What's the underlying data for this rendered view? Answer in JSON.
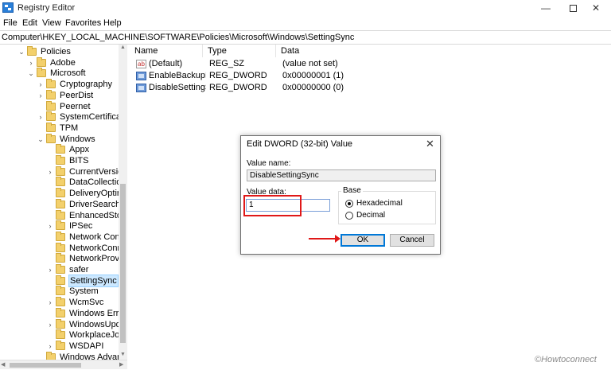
{
  "window": {
    "title": "Registry Editor",
    "min_glyph": "—",
    "close_glyph": "✕"
  },
  "menu": [
    "File",
    "Edit",
    "View",
    "Favorites",
    "Help"
  ],
  "address": "Computer\\HKEY_LOCAL_MACHINE\\SOFTWARE\\Policies\\Microsoft\\Windows\\SettingSync",
  "tree": [
    {
      "label": "Policies",
      "chev": "⌄",
      "level": 0
    },
    {
      "label": "Adobe",
      "chev": "›",
      "level": 1
    },
    {
      "label": "Microsoft",
      "chev": "⌄",
      "level": 1
    },
    {
      "label": "Cryptography",
      "chev": "›",
      "level": 2
    },
    {
      "label": "PeerDist",
      "chev": "›",
      "level": 2
    },
    {
      "label": "Peernet",
      "chev": "",
      "level": 2
    },
    {
      "label": "SystemCertificates",
      "chev": "›",
      "level": 2
    },
    {
      "label": "TPM",
      "chev": "",
      "level": 2
    },
    {
      "label": "Windows",
      "chev": "⌄",
      "level": 2
    },
    {
      "label": "Appx",
      "chev": "",
      "level": 3
    },
    {
      "label": "BITS",
      "chev": "",
      "level": 3
    },
    {
      "label": "CurrentVersion",
      "chev": "›",
      "level": 3
    },
    {
      "label": "DataCollection",
      "chev": "",
      "level": 3
    },
    {
      "label": "DeliveryOptimiz",
      "chev": "",
      "level": 3
    },
    {
      "label": "DriverSearching",
      "chev": "",
      "level": 3
    },
    {
      "label": "EnhancedStorag",
      "chev": "",
      "level": 3
    },
    {
      "label": "IPSec",
      "chev": "›",
      "level": 3
    },
    {
      "label": "Network Conne",
      "chev": "",
      "level": 3
    },
    {
      "label": "NetworkConnec",
      "chev": "",
      "level": 3
    },
    {
      "label": "NetworkProvide",
      "chev": "",
      "level": 3
    },
    {
      "label": "safer",
      "chev": "›",
      "level": 3
    },
    {
      "label": "SettingSync",
      "chev": "",
      "level": 3,
      "selected": true
    },
    {
      "label": "System",
      "chev": "",
      "level": 3
    },
    {
      "label": "WcmSvc",
      "chev": "›",
      "level": 3
    },
    {
      "label": "Windows Error I",
      "chev": "",
      "level": 3
    },
    {
      "label": "WindowsUpdat",
      "chev": "›",
      "level": 3
    },
    {
      "label": "WorkplaceJoin",
      "chev": "",
      "level": 3
    },
    {
      "label": "WSDAPI",
      "chev": "›",
      "level": 3
    },
    {
      "label": "Windows Advance",
      "chev": "",
      "level": 2
    }
  ],
  "list": {
    "headers": {
      "name": "Name",
      "type": "Type",
      "data": "Data"
    },
    "rows": [
      {
        "icon": "string-value-icon",
        "name": "(Default)",
        "type": "REG_SZ",
        "data": "(value not set)"
      },
      {
        "icon": "dword-value-icon",
        "name": "EnableBackupFo...",
        "type": "REG_DWORD",
        "data": "0x00000001 (1)"
      },
      {
        "icon": "dword-value-icon",
        "name": "DisableSettingSy...",
        "type": "REG_DWORD",
        "data": "0x00000000 (0)"
      }
    ]
  },
  "dialog": {
    "title": "Edit DWORD (32-bit) Value",
    "close_glyph": "✕",
    "value_name_label": "Value name:",
    "value_name": "DisableSettingSync",
    "value_data_label": "Value data:",
    "value_data": "1",
    "base_label": "Base",
    "base_options": [
      {
        "label": "Hexadecimal",
        "checked": true
      },
      {
        "label": "Decimal",
        "checked": false
      }
    ],
    "ok_label": "OK",
    "cancel_label": "Cancel"
  },
  "watermark": "©Howtoconnect",
  "colors": {
    "highlight": "#e01818",
    "selection": "#cce8ff",
    "folder": "#f3d06c",
    "focus_border": "#0078d7"
  }
}
